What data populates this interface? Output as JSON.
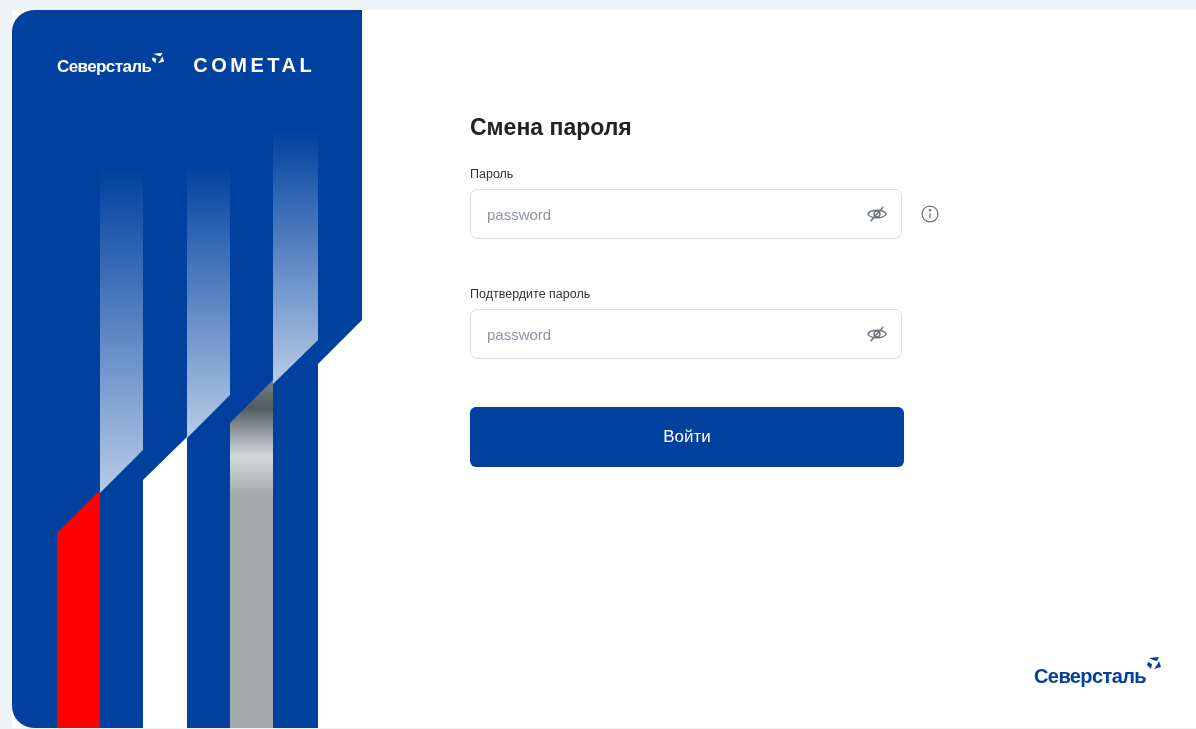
{
  "brand_panel": {
    "logo": "Северсталь",
    "partner_logo": "COMETAL"
  },
  "form": {
    "title": "Смена пароля",
    "fields": [
      {
        "label": "Пароль",
        "placeholder": "password",
        "info": true
      },
      {
        "label": "Подтвердите пароль",
        "placeholder": "password",
        "info": false
      }
    ],
    "submit": "Войти"
  },
  "footer_logo": "Северсталь"
}
